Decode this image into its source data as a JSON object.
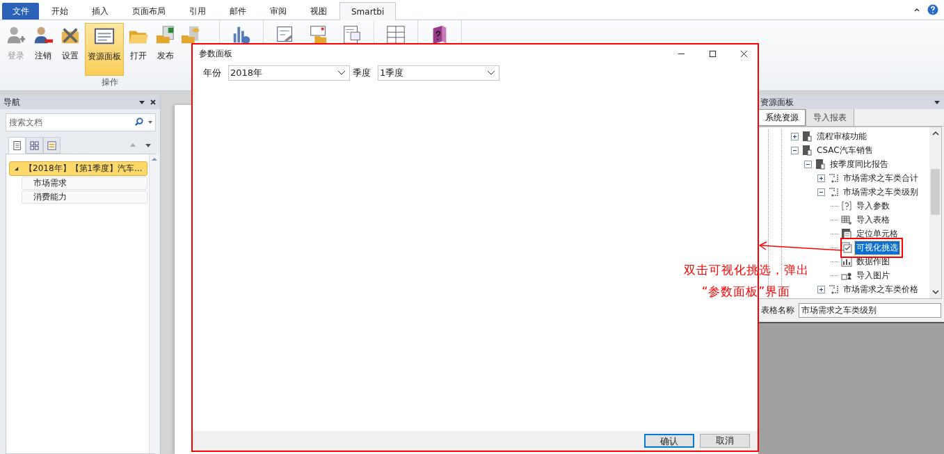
{
  "ribbon": {
    "tabs": [
      {
        "label": "文件",
        "kind": "file",
        "selected": false
      },
      {
        "label": "开始",
        "kind": "tab",
        "selected": false
      },
      {
        "label": "插入",
        "kind": "tab",
        "selected": false
      },
      {
        "label": "页面布局",
        "kind": "tab",
        "selected": false
      },
      {
        "label": "引用",
        "kind": "tab",
        "selected": false
      },
      {
        "label": "邮件",
        "kind": "tab",
        "selected": false
      },
      {
        "label": "审阅",
        "kind": "tab",
        "selected": false
      },
      {
        "label": "视图",
        "kind": "tab",
        "selected": false
      },
      {
        "label": "Smartbi",
        "kind": "tab",
        "selected": true
      }
    ],
    "buttons": [
      {
        "label": "登录",
        "disabled": true,
        "selected": false
      },
      {
        "label": "注销",
        "disabled": false,
        "selected": false
      },
      {
        "label": "设置",
        "disabled": false,
        "selected": false
      },
      {
        "label": "资源面板",
        "disabled": false,
        "selected": true
      },
      {
        "label": "打开",
        "disabled": false,
        "selected": false
      },
      {
        "label": "发布",
        "disabled": false,
        "selected": false
      }
    ],
    "group_label": "操作"
  },
  "navigation": {
    "title": "导航",
    "search": {
      "placeholder": "搜索文档"
    },
    "view_tabs": [
      {
        "selected": true
      },
      {
        "selected": false
      },
      {
        "selected": false
      }
    ],
    "tree": [
      {
        "label": "【2018年】【第1季度】汽车...",
        "expanded": true,
        "selected": true,
        "children": [
          {
            "label": "市场需求",
            "selected": false
          },
          {
            "label": "消费能力",
            "selected": false
          }
        ]
      }
    ]
  },
  "dialog": {
    "title": "参数面板",
    "params": [
      {
        "label": "年份",
        "value": "2018年"
      },
      {
        "label": "季度",
        "value": "1季度"
      }
    ],
    "buttons": [
      {
        "label": "确认",
        "focused": true
      },
      {
        "label": "取消",
        "focused": false
      }
    ]
  },
  "resource_panel": {
    "title": "资源面板",
    "tabs": [
      {
        "label": "系统资源",
        "selected": true
      },
      {
        "label": "导入报表",
        "selected": false
      }
    ],
    "tree": [
      {
        "label": "流程审核功能",
        "kind": "folder",
        "expanded": false,
        "selected": false
      },
      {
        "label": "CSAC汽车销售",
        "kind": "folder",
        "expanded": true,
        "selected": false,
        "children": [
          {
            "label": "按季度同比报告",
            "kind": "folder",
            "expanded": true,
            "selected": false,
            "children": [
              {
                "label": "市场需求之车类合计",
                "kind": "report",
                "expanded": false,
                "selected": false
              },
              {
                "label": "市场需求之车类级别",
                "kind": "report",
                "expanded": true,
                "selected": false,
                "children": [
                  {
                    "label": "导入参数",
                    "kind": "param",
                    "selected": false
                  },
                  {
                    "label": "导入表格",
                    "kind": "table",
                    "selected": false
                  },
                  {
                    "label": "定位单元格",
                    "kind": "cell",
                    "selected": false
                  },
                  {
                    "label": "可视化挑选",
                    "kind": "filter",
                    "selected": true
                  },
                  {
                    "label": "数据作图",
                    "kind": "chart",
                    "selected": false
                  },
                  {
                    "label": "导入图片",
                    "kind": "image",
                    "selected": false
                  }
                ]
              },
              {
                "label": "市场需求之车类价格",
                "kind": "report",
                "expanded": false,
                "selected": false
              }
            ]
          }
        ]
      }
    ],
    "table_name": {
      "label": "表格名称",
      "value": "市场需求之车类级别"
    }
  },
  "annotation": {
    "lines": [
      "双击可视化挑选，弹出",
      "“参数面板”界面"
    ]
  }
}
